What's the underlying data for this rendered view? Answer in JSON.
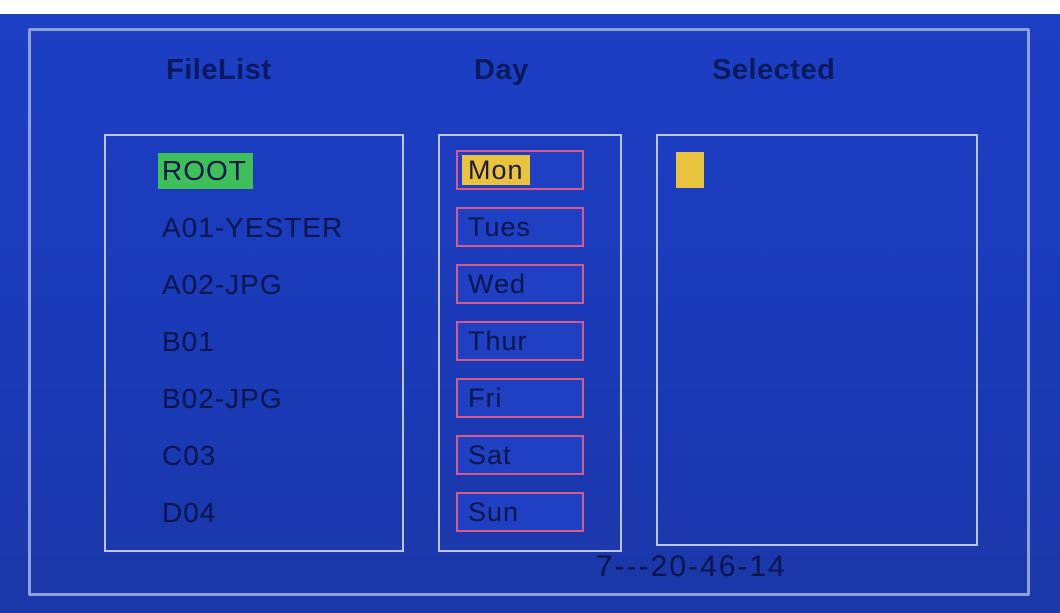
{
  "headers": {
    "filelist": "FileList",
    "day": "Day",
    "selected": "Selected"
  },
  "files": [
    {
      "label": "ROOT",
      "selected": true
    },
    {
      "label": "A01-YESTER"
    },
    {
      "label": "A02-JPG"
    },
    {
      "label": "B01"
    },
    {
      "label": "B02-JPG"
    },
    {
      "label": "C03"
    },
    {
      "label": "D04"
    }
  ],
  "days": [
    {
      "label": "Mon",
      "active": true
    },
    {
      "label": "Tues"
    },
    {
      "label": "Wed"
    },
    {
      "label": "Thur"
    },
    {
      "label": "Fri"
    },
    {
      "label": "Sat"
    },
    {
      "label": "Sun"
    }
  ],
  "footer": {
    "code": "7---20-46-14"
  },
  "colors": {
    "background": "#1d3fc4",
    "file_selected": "#3fbf5a",
    "day_selected": "#e9c33d",
    "day_border": "#d75a88"
  }
}
